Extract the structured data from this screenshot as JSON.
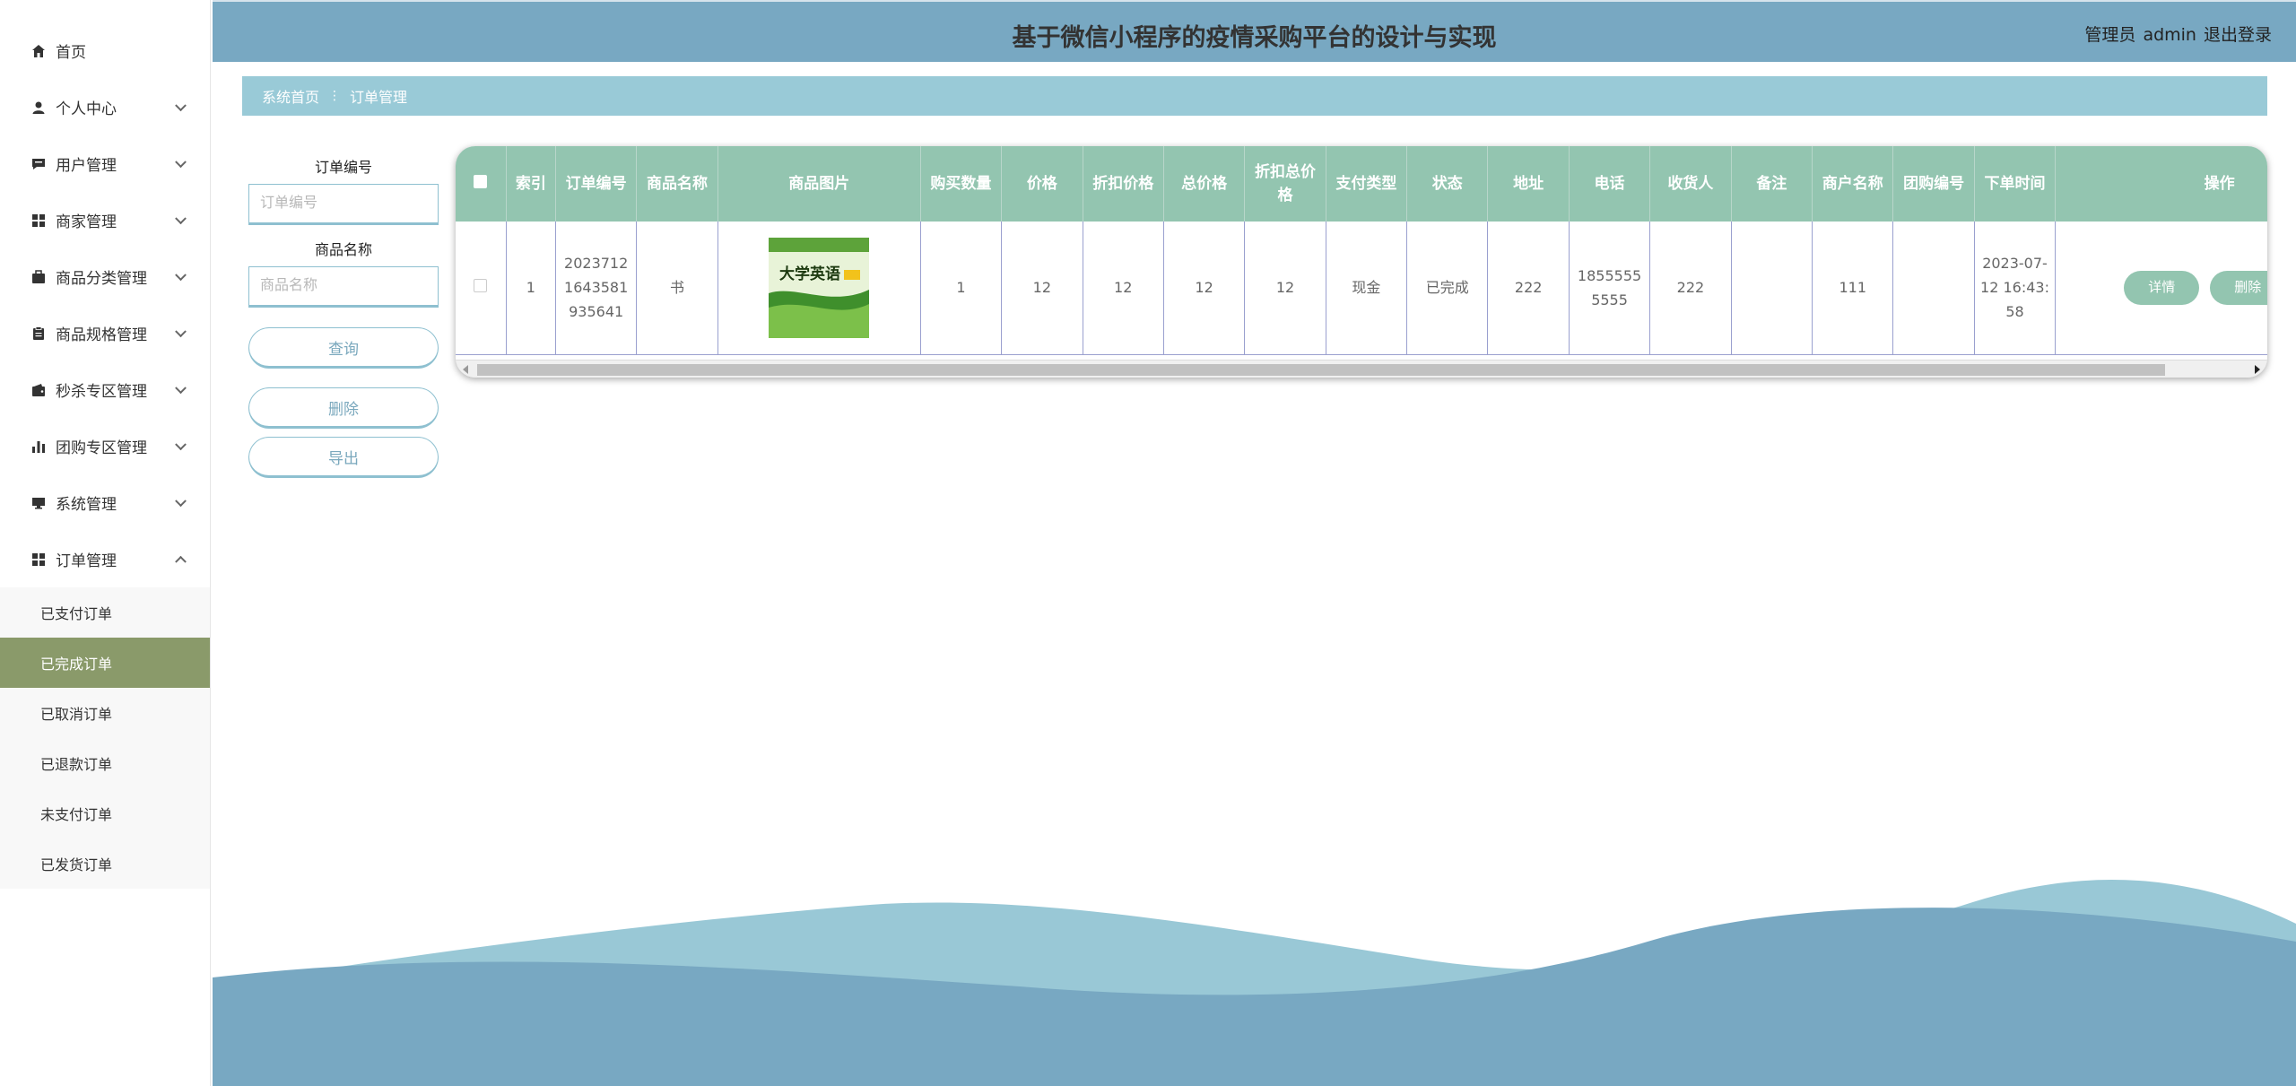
{
  "header": {
    "title": "基于微信小程序的疫情采购平台的设计与实现",
    "role": "管理员",
    "username": "admin",
    "logout": "退出登录"
  },
  "sidebar": {
    "items": [
      {
        "label": "首页",
        "icon": "home-icon"
      },
      {
        "label": "个人中心",
        "icon": "user-icon"
      },
      {
        "label": "用户管理",
        "icon": "chat-icon"
      },
      {
        "label": "商家管理",
        "icon": "grid-icon"
      },
      {
        "label": "商品分类管理",
        "icon": "briefcase-icon"
      },
      {
        "label": "商品规格管理",
        "icon": "clipboard-icon"
      },
      {
        "label": "秒杀专区管理",
        "icon": "wallet-icon"
      },
      {
        "label": "团购专区管理",
        "icon": "bar-chart-icon"
      },
      {
        "label": "系统管理",
        "icon": "monitor-icon"
      },
      {
        "label": "订单管理",
        "icon": "grid-icon"
      }
    ],
    "submenu": [
      "已支付订单",
      "已完成订单",
      "已取消订单",
      "已退款订单",
      "未支付订单",
      "已发货订单"
    ],
    "active_sub": "已完成订单"
  },
  "breadcrumb": {
    "home": "系统首页",
    "current": "订单管理"
  },
  "filter": {
    "order_no_label": "订单编号",
    "order_no_placeholder": "订单编号",
    "product_name_label": "商品名称",
    "product_name_placeholder": "商品名称",
    "search": "查询",
    "delete": "删除",
    "export": "导出"
  },
  "table": {
    "headers": [
      "索引",
      "订单编号",
      "商品名称",
      "商品图片",
      "购买数量",
      "价格",
      "折扣价格",
      "总价格",
      "折扣总价格",
      "支付类型",
      "状态",
      "地址",
      "电话",
      "收货人",
      "备注",
      "商户名称",
      "团购编号",
      "下单时间",
      "操作"
    ],
    "rows": [
      {
        "index": "1",
        "order_no": "20237121643581935641",
        "product_name": "书",
        "image_title": "大学英语",
        "quantity": "1",
        "price": "12",
        "discount_price": "12",
        "total_price": "12",
        "discount_total": "12",
        "pay_type": "现金",
        "status": "已完成",
        "address": "222",
        "phone": "18555555555",
        "receiver": "222",
        "remark": "",
        "merchant": "111",
        "group_no": "",
        "order_time": "2023-07-12 16:43:58"
      }
    ],
    "actions": {
      "detail": "详情",
      "delete": "删除"
    }
  },
  "colors": {
    "header_bg": "#78a8c2",
    "breadcrumb_bg": "#99cad7",
    "table_header_bg": "#93c5b0",
    "active_menu_bg": "#8a9a6a",
    "wave_light": "#99c8d6",
    "wave_dark": "#78a8c2"
  }
}
